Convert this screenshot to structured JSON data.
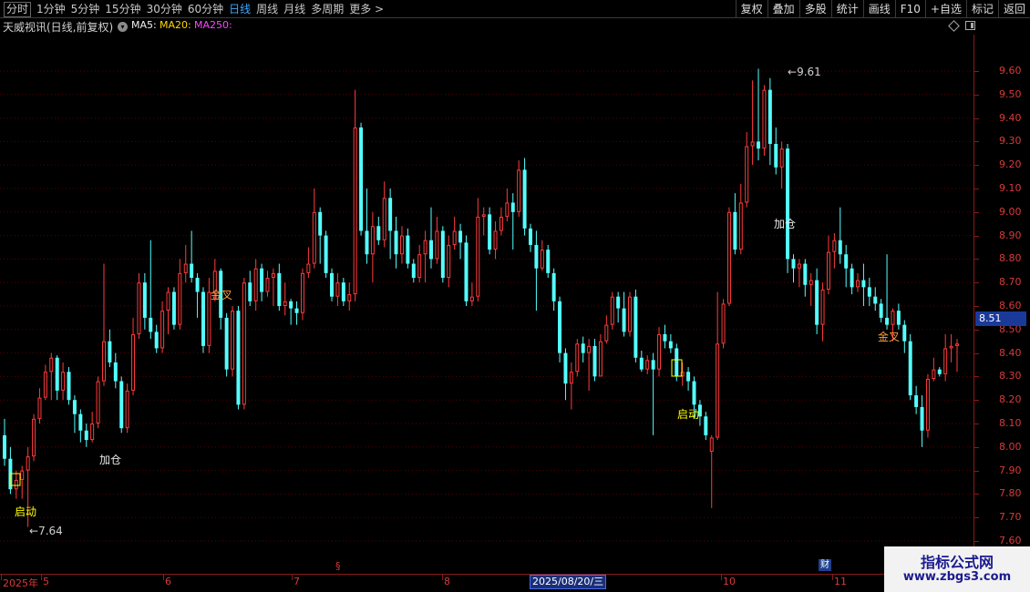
{
  "toolbar": {
    "periods": [
      "分时",
      "1分钟",
      "5分钟",
      "15分钟",
      "30分钟",
      "60分钟",
      "日线",
      "周线",
      "月线",
      "多周期",
      "更多 >"
    ],
    "active_period": "日线",
    "tools": [
      "复权",
      "叠加",
      "多股",
      "统计",
      "画线",
      "F10",
      "+自选",
      "标记",
      "返回"
    ]
  },
  "title": {
    "stock": "天威视讯(日线,前复权)",
    "ma5": "MA5:",
    "ma20": "MA20:",
    "ma250": "MA250:"
  },
  "colors": {
    "up": "#ff3b3b",
    "down": "#54ffff",
    "grid": "#5a0000",
    "ma5": "#f0f0f0",
    "ma20": "#ffd700",
    "ma250": "#ff44ff",
    "signal_yellow": "#ffff00",
    "signal_orange": "#ffa040"
  },
  "y_axis": {
    "ticks": [
      "9.60",
      "9.50",
      "9.40",
      "9.30",
      "9.20",
      "9.10",
      "9.00",
      "8.90",
      "8.80",
      "8.70",
      "8.60",
      "8.50",
      "8.40",
      "8.30",
      "8.20",
      "8.10",
      "8.00",
      "7.90",
      "7.80",
      "7.70",
      "7.60"
    ],
    "current_price": "8.51"
  },
  "x_axis": {
    "labels": [
      "2025年",
      "5",
      "6",
      "7",
      "8",
      "10",
      "11"
    ],
    "cursor_date": "2025/08/20/三",
    "finance_badge": "财",
    "section_mark": "§"
  },
  "annotations": {
    "high_label": "9.61",
    "low_label": "7.64",
    "start": "启动",
    "add": "加仓",
    "golden_cross": "金叉"
  },
  "watermark": {
    "line1": "指标公式网",
    "line2": "www.zbgs3.com"
  },
  "chart_data": {
    "type": "candlestick",
    "ylim": [
      7.58,
      9.68
    ],
    "grid": true,
    "candles": [
      [
        8.05,
        7.95,
        8.12,
        7.92
      ],
      [
        7.95,
        7.82,
        8.0,
        7.8
      ],
      [
        7.82,
        7.86,
        7.9,
        7.78
      ],
      [
        7.86,
        7.9,
        7.92,
        7.78
      ],
      [
        7.9,
        7.96,
        8.0,
        7.66
      ],
      [
        7.96,
        8.12,
        8.14,
        7.94
      ],
      [
        8.12,
        8.21,
        8.25,
        8.1
      ],
      [
        8.21,
        8.32,
        8.35,
        8.2
      ],
      [
        8.32,
        8.38,
        8.4,
        8.2
      ],
      [
        8.38,
        8.24,
        8.39,
        8.2
      ],
      [
        8.24,
        8.32,
        8.36,
        8.2
      ],
      [
        8.32,
        8.2,
        8.34,
        8.18
      ],
      [
        8.2,
        8.14,
        8.22,
        8.06
      ],
      [
        8.14,
        8.07,
        8.16,
        8.02
      ],
      [
        8.07,
        8.03,
        8.1,
        8.0
      ],
      [
        8.03,
        8.1,
        8.15,
        8.02
      ],
      [
        8.1,
        8.28,
        8.3,
        8.08
      ],
      [
        8.28,
        8.45,
        8.78,
        8.26
      ],
      [
        8.45,
        8.36,
        8.5,
        8.34
      ],
      [
        8.36,
        8.28,
        8.4,
        8.25
      ],
      [
        8.28,
        8.08,
        8.3,
        8.06
      ],
      [
        8.08,
        8.24,
        8.27,
        8.06
      ],
      [
        8.24,
        8.48,
        8.55,
        8.22
      ],
      [
        8.48,
        8.7,
        8.74,
        8.46
      ],
      [
        8.7,
        8.55,
        8.74,
        8.5
      ],
      [
        8.55,
        8.49,
        8.88,
        8.46
      ],
      [
        8.49,
        8.42,
        8.52,
        8.4
      ],
      [
        8.42,
        8.58,
        8.62,
        8.4
      ],
      [
        8.58,
        8.66,
        8.68,
        8.48
      ],
      [
        8.66,
        8.52,
        8.68,
        8.5
      ],
      [
        8.52,
        8.74,
        8.8,
        8.5
      ],
      [
        8.74,
        8.78,
        8.86,
        8.7
      ],
      [
        8.78,
        8.72,
        8.92,
        8.7
      ],
      [
        8.72,
        8.66,
        8.74,
        8.55
      ],
      [
        8.66,
        8.43,
        8.68,
        8.4
      ],
      [
        8.43,
        8.66,
        8.72,
        8.4
      ],
      [
        8.66,
        8.75,
        8.8,
        8.62
      ],
      [
        8.75,
        8.55,
        8.76,
        8.5
      ],
      [
        8.55,
        8.33,
        8.57,
        8.3
      ],
      [
        8.33,
        8.58,
        8.6,
        8.3
      ],
      [
        8.58,
        8.18,
        8.6,
        8.16
      ],
      [
        8.18,
        8.7,
        8.72,
        8.16
      ],
      [
        8.7,
        8.62,
        8.75,
        8.6
      ],
      [
        8.62,
        8.76,
        8.8,
        8.58
      ],
      [
        8.76,
        8.66,
        8.78,
        8.62
      ],
      [
        8.66,
        8.72,
        8.75,
        8.64
      ],
      [
        8.72,
        8.74,
        8.76,
        8.6
      ],
      [
        8.74,
        8.6,
        8.78,
        8.58
      ],
      [
        8.6,
        8.62,
        8.7,
        8.56
      ],
      [
        8.62,
        8.59,
        8.63,
        8.52
      ],
      [
        8.59,
        8.57,
        8.62,
        8.52
      ],
      [
        8.57,
        8.74,
        8.76,
        8.54
      ],
      [
        8.74,
        8.78,
        8.85,
        8.72
      ],
      [
        8.78,
        9.0,
        9.1,
        8.76
      ],
      [
        9.0,
        8.9,
        9.02,
        8.78
      ],
      [
        8.9,
        8.74,
        8.92,
        8.72
      ],
      [
        8.74,
        8.64,
        8.76,
        8.62
      ],
      [
        8.64,
        8.7,
        8.74,
        8.6
      ],
      [
        8.7,
        8.62,
        8.72,
        8.6
      ],
      [
        8.62,
        8.65,
        8.7,
        8.58
      ],
      [
        8.65,
        9.36,
        9.52,
        8.62
      ],
      [
        9.36,
        8.92,
        9.38,
        8.9
      ],
      [
        8.92,
        8.82,
        9.1,
        8.78
      ],
      [
        8.82,
        8.94,
        9.0,
        8.7
      ],
      [
        8.94,
        8.88,
        8.98,
        8.86
      ],
      [
        8.88,
        9.06,
        9.13,
        8.85
      ],
      [
        9.06,
        8.92,
        9.1,
        8.8
      ],
      [
        8.92,
        8.82,
        8.98,
        8.76
      ],
      [
        8.82,
        8.9,
        8.94,
        8.78
      ],
      [
        8.9,
        8.78,
        8.93,
        8.76
      ],
      [
        8.78,
        8.72,
        8.8,
        8.7
      ],
      [
        8.72,
        8.82,
        8.86,
        8.7
      ],
      [
        8.82,
        8.88,
        8.92,
        8.7
      ],
      [
        8.88,
        8.8,
        9.02,
        8.76
      ],
      [
        8.8,
        8.92,
        8.98,
        8.78
      ],
      [
        8.92,
        8.72,
        8.94,
        8.7
      ],
      [
        8.72,
        8.86,
        8.9,
        8.68
      ],
      [
        8.86,
        8.92,
        8.98,
        8.84
      ],
      [
        8.92,
        8.87,
        8.95,
        8.8
      ],
      [
        8.87,
        8.62,
        8.9,
        8.6
      ],
      [
        8.62,
        8.64,
        8.7,
        8.6
      ],
      [
        8.64,
        8.98,
        9.06,
        8.62
      ],
      [
        8.98,
        8.99,
        9.02,
        8.9
      ],
      [
        8.99,
        8.84,
        9.02,
        8.82
      ],
      [
        8.84,
        8.92,
        8.96,
        8.8
      ],
      [
        8.92,
        8.98,
        9.02,
        8.9
      ],
      [
        8.98,
        9.04,
        9.1,
        8.96
      ],
      [
        9.04,
        9.0,
        9.08,
        8.84
      ],
      [
        9.0,
        9.18,
        9.22,
        8.98
      ],
      [
        9.18,
        8.93,
        9.23,
        8.9
      ],
      [
        8.93,
        8.86,
        8.95,
        8.83
      ],
      [
        8.86,
        8.76,
        8.92,
        8.58
      ],
      [
        8.76,
        8.84,
        8.88,
        8.75
      ],
      [
        8.84,
        8.74,
        8.86,
        8.72
      ],
      [
        8.74,
        8.62,
        8.76,
        8.58
      ],
      [
        8.62,
        8.4,
        8.64,
        8.36
      ],
      [
        8.4,
        8.27,
        8.42,
        8.2
      ],
      [
        8.27,
        8.32,
        8.36,
        8.16
      ],
      [
        8.32,
        8.44,
        8.46,
        8.3
      ],
      [
        8.44,
        8.4,
        8.47,
        8.36
      ],
      [
        8.4,
        8.43,
        8.46,
        8.24
      ],
      [
        8.43,
        8.3,
        8.46,
        8.28
      ],
      [
        8.3,
        8.45,
        8.48,
        8.42
      ],
      [
        8.45,
        8.52,
        8.56,
        8.44
      ],
      [
        8.52,
        8.64,
        8.66,
        8.5
      ],
      [
        8.64,
        8.59,
        8.66,
        8.53
      ],
      [
        8.59,
        8.49,
        8.66,
        8.47
      ],
      [
        8.49,
        8.64,
        8.66,
        8.47
      ],
      [
        8.64,
        8.38,
        8.67,
        8.36
      ],
      [
        8.38,
        8.33,
        8.41,
        8.32
      ],
      [
        8.33,
        8.37,
        8.39,
        8.31
      ],
      [
        8.37,
        8.33,
        8.4,
        8.05
      ],
      [
        8.33,
        8.48,
        8.51,
        8.3
      ],
      [
        8.48,
        8.45,
        8.52,
        8.42
      ],
      [
        8.45,
        8.42,
        8.48,
        8.4
      ],
      [
        8.42,
        8.3,
        8.44,
        8.28
      ],
      [
        8.3,
        8.32,
        8.36,
        8.26
      ],
      [
        8.32,
        8.28,
        8.34,
        8.24
      ],
      [
        8.28,
        8.18,
        8.3,
        8.12
      ],
      [
        8.18,
        8.13,
        8.2,
        8.09
      ],
      [
        8.13,
        8.05,
        8.15,
        8.03
      ],
      [
        7.98,
        8.04,
        8.05,
        7.74
      ],
      [
        8.04,
        8.44,
        8.66,
        8.03
      ],
      [
        8.44,
        8.61,
        8.63,
        8.42
      ],
      [
        8.61,
        9.0,
        9.02,
        8.6
      ],
      [
        9.0,
        8.84,
        9.08,
        8.82
      ],
      [
        8.84,
        9.04,
        9.12,
        8.82
      ],
      [
        9.04,
        9.28,
        9.34,
        9.02
      ],
      [
        9.28,
        9.3,
        9.56,
        9.2
      ],
      [
        9.3,
        9.27,
        9.61,
        9.22
      ],
      [
        9.27,
        9.52,
        9.54,
        9.24
      ],
      [
        9.52,
        9.29,
        9.57,
        9.2
      ],
      [
        9.29,
        9.19,
        9.36,
        9.16
      ],
      [
        9.19,
        9.27,
        9.3,
        9.1
      ],
      [
        9.27,
        8.8,
        9.29,
        8.74
      ],
      [
        8.8,
        8.76,
        8.82,
        8.7
      ],
      [
        8.76,
        8.78,
        8.8,
        8.68
      ],
      [
        8.78,
        8.69,
        8.8,
        8.64
      ],
      [
        8.69,
        8.71,
        8.74,
        8.6
      ],
      [
        8.71,
        8.52,
        8.76,
        8.48
      ],
      [
        8.52,
        8.67,
        8.7,
        8.45
      ],
      [
        8.67,
        8.83,
        8.9,
        8.65
      ],
      [
        8.83,
        8.88,
        8.91,
        8.76
      ],
      [
        8.88,
        8.82,
        9.02,
        8.78
      ],
      [
        8.82,
        8.76,
        8.86,
        8.68
      ],
      [
        8.76,
        8.68,
        8.78,
        8.65
      ],
      [
        8.68,
        8.71,
        8.74,
        8.66
      ],
      [
        8.71,
        8.68,
        8.78,
        8.6
      ],
      [
        8.68,
        8.64,
        8.72,
        8.6
      ],
      [
        8.64,
        8.61,
        8.68,
        8.58
      ],
      [
        8.61,
        8.55,
        8.63,
        8.53
      ],
      [
        8.55,
        8.52,
        8.82,
        8.5
      ],
      [
        8.52,
        8.58,
        8.59,
        8.45
      ],
      [
        8.58,
        8.52,
        8.61,
        8.5
      ],
      [
        8.52,
        8.45,
        8.54,
        8.4
      ],
      [
        8.45,
        8.22,
        8.48,
        8.2
      ],
      [
        8.22,
        8.17,
        8.26,
        8.14
      ],
      [
        8.17,
        8.07,
        8.22,
        8.0
      ],
      [
        8.07,
        8.29,
        8.31,
        8.04
      ],
      [
        8.29,
        8.33,
        8.38,
        8.28
      ],
      [
        8.33,
        8.31,
        8.34,
        8.3
      ],
      [
        8.31,
        8.42,
        8.48,
        8.28
      ],
      [
        8.42,
        8.43,
        8.48,
        8.36
      ],
      [
        8.43,
        8.44,
        8.46,
        8.32
      ]
    ]
  }
}
